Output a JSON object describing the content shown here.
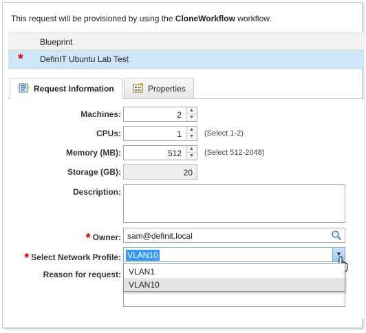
{
  "intro": {
    "prefix": "This request will be provisioned by using the ",
    "workflow": "CloneWorkflow",
    "suffix": " workflow."
  },
  "blueprint_table": {
    "header": "Blueprint",
    "rows": [
      {
        "required_mark": "*",
        "name": "DefinIT Ubuntu Lab Test"
      }
    ]
  },
  "tabs": [
    {
      "label": "Request Information",
      "active": true,
      "icon": "form-icon"
    },
    {
      "label": "Properties",
      "active": false,
      "icon": "properties-icon"
    }
  ],
  "form": {
    "machines": {
      "label": "Machines:",
      "value": "2"
    },
    "cpus": {
      "label": "CPUs:",
      "value": "1",
      "hint": "(Select 1-2)"
    },
    "memory": {
      "label": "Memory (MB):",
      "value": "512",
      "hint": "(Select 512-2048)"
    },
    "storage": {
      "label": "Storage (GB):",
      "value": "20"
    },
    "description": {
      "label": "Description:",
      "value": ""
    },
    "owner": {
      "required_mark": "*",
      "label": "Owner:",
      "value": "sam@definit.local"
    },
    "network_profile": {
      "required_mark": "*",
      "label": "Select Network Profile:",
      "value": "VLAN10",
      "options": [
        "VLAN1",
        "VLAN10"
      ],
      "highlighted": "VLAN10"
    },
    "reason": {
      "label": "Reason for request:",
      "value": ""
    }
  },
  "colors": {
    "required": "#d10000",
    "selected_row": "#cfe6f7",
    "selection": "#3399ff"
  }
}
